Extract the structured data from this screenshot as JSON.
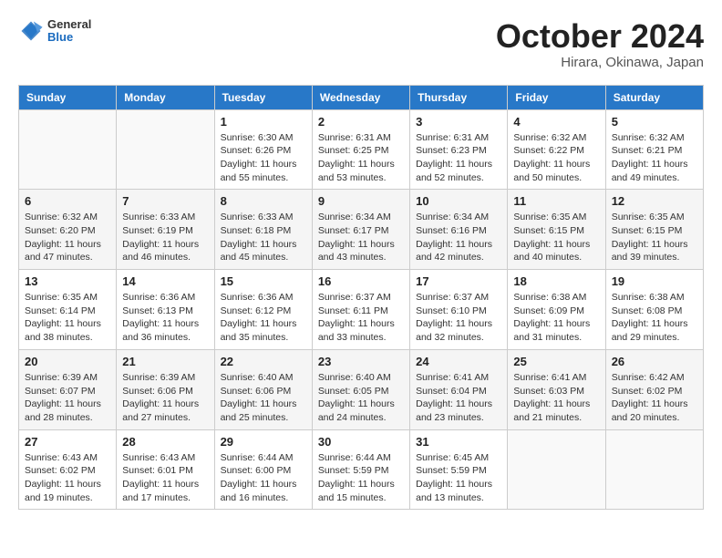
{
  "header": {
    "logo_general": "General",
    "logo_blue": "Blue",
    "month_title": "October 2024",
    "subtitle": "Hirara, Okinawa, Japan"
  },
  "days_of_week": [
    "Sunday",
    "Monday",
    "Tuesday",
    "Wednesday",
    "Thursday",
    "Friday",
    "Saturday"
  ],
  "weeks": [
    [
      {
        "day": "",
        "sunrise": "",
        "sunset": "",
        "daylight": ""
      },
      {
        "day": "",
        "sunrise": "",
        "sunset": "",
        "daylight": ""
      },
      {
        "day": "1",
        "sunrise": "Sunrise: 6:30 AM",
        "sunset": "Sunset: 6:26 PM",
        "daylight": "Daylight: 11 hours and 55 minutes."
      },
      {
        "day": "2",
        "sunrise": "Sunrise: 6:31 AM",
        "sunset": "Sunset: 6:25 PM",
        "daylight": "Daylight: 11 hours and 53 minutes."
      },
      {
        "day": "3",
        "sunrise": "Sunrise: 6:31 AM",
        "sunset": "Sunset: 6:23 PM",
        "daylight": "Daylight: 11 hours and 52 minutes."
      },
      {
        "day": "4",
        "sunrise": "Sunrise: 6:32 AM",
        "sunset": "Sunset: 6:22 PM",
        "daylight": "Daylight: 11 hours and 50 minutes."
      },
      {
        "day": "5",
        "sunrise": "Sunrise: 6:32 AM",
        "sunset": "Sunset: 6:21 PM",
        "daylight": "Daylight: 11 hours and 49 minutes."
      }
    ],
    [
      {
        "day": "6",
        "sunrise": "Sunrise: 6:32 AM",
        "sunset": "Sunset: 6:20 PM",
        "daylight": "Daylight: 11 hours and 47 minutes."
      },
      {
        "day": "7",
        "sunrise": "Sunrise: 6:33 AM",
        "sunset": "Sunset: 6:19 PM",
        "daylight": "Daylight: 11 hours and 46 minutes."
      },
      {
        "day": "8",
        "sunrise": "Sunrise: 6:33 AM",
        "sunset": "Sunset: 6:18 PM",
        "daylight": "Daylight: 11 hours and 45 minutes."
      },
      {
        "day": "9",
        "sunrise": "Sunrise: 6:34 AM",
        "sunset": "Sunset: 6:17 PM",
        "daylight": "Daylight: 11 hours and 43 minutes."
      },
      {
        "day": "10",
        "sunrise": "Sunrise: 6:34 AM",
        "sunset": "Sunset: 6:16 PM",
        "daylight": "Daylight: 11 hours and 42 minutes."
      },
      {
        "day": "11",
        "sunrise": "Sunrise: 6:35 AM",
        "sunset": "Sunset: 6:15 PM",
        "daylight": "Daylight: 11 hours and 40 minutes."
      },
      {
        "day": "12",
        "sunrise": "Sunrise: 6:35 AM",
        "sunset": "Sunset: 6:15 PM",
        "daylight": "Daylight: 11 hours and 39 minutes."
      }
    ],
    [
      {
        "day": "13",
        "sunrise": "Sunrise: 6:35 AM",
        "sunset": "Sunset: 6:14 PM",
        "daylight": "Daylight: 11 hours and 38 minutes."
      },
      {
        "day": "14",
        "sunrise": "Sunrise: 6:36 AM",
        "sunset": "Sunset: 6:13 PM",
        "daylight": "Daylight: 11 hours and 36 minutes."
      },
      {
        "day": "15",
        "sunrise": "Sunrise: 6:36 AM",
        "sunset": "Sunset: 6:12 PM",
        "daylight": "Daylight: 11 hours and 35 minutes."
      },
      {
        "day": "16",
        "sunrise": "Sunrise: 6:37 AM",
        "sunset": "Sunset: 6:11 PM",
        "daylight": "Daylight: 11 hours and 33 minutes."
      },
      {
        "day": "17",
        "sunrise": "Sunrise: 6:37 AM",
        "sunset": "Sunset: 6:10 PM",
        "daylight": "Daylight: 11 hours and 32 minutes."
      },
      {
        "day": "18",
        "sunrise": "Sunrise: 6:38 AM",
        "sunset": "Sunset: 6:09 PM",
        "daylight": "Daylight: 11 hours and 31 minutes."
      },
      {
        "day": "19",
        "sunrise": "Sunrise: 6:38 AM",
        "sunset": "Sunset: 6:08 PM",
        "daylight": "Daylight: 11 hours and 29 minutes."
      }
    ],
    [
      {
        "day": "20",
        "sunrise": "Sunrise: 6:39 AM",
        "sunset": "Sunset: 6:07 PM",
        "daylight": "Daylight: 11 hours and 28 minutes."
      },
      {
        "day": "21",
        "sunrise": "Sunrise: 6:39 AM",
        "sunset": "Sunset: 6:06 PM",
        "daylight": "Daylight: 11 hours and 27 minutes."
      },
      {
        "day": "22",
        "sunrise": "Sunrise: 6:40 AM",
        "sunset": "Sunset: 6:06 PM",
        "daylight": "Daylight: 11 hours and 25 minutes."
      },
      {
        "day": "23",
        "sunrise": "Sunrise: 6:40 AM",
        "sunset": "Sunset: 6:05 PM",
        "daylight": "Daylight: 11 hours and 24 minutes."
      },
      {
        "day": "24",
        "sunrise": "Sunrise: 6:41 AM",
        "sunset": "Sunset: 6:04 PM",
        "daylight": "Daylight: 11 hours and 23 minutes."
      },
      {
        "day": "25",
        "sunrise": "Sunrise: 6:41 AM",
        "sunset": "Sunset: 6:03 PM",
        "daylight": "Daylight: 11 hours and 21 minutes."
      },
      {
        "day": "26",
        "sunrise": "Sunrise: 6:42 AM",
        "sunset": "Sunset: 6:02 PM",
        "daylight": "Daylight: 11 hours and 20 minutes."
      }
    ],
    [
      {
        "day": "27",
        "sunrise": "Sunrise: 6:43 AM",
        "sunset": "Sunset: 6:02 PM",
        "daylight": "Daylight: 11 hours and 19 minutes."
      },
      {
        "day": "28",
        "sunrise": "Sunrise: 6:43 AM",
        "sunset": "Sunset: 6:01 PM",
        "daylight": "Daylight: 11 hours and 17 minutes."
      },
      {
        "day": "29",
        "sunrise": "Sunrise: 6:44 AM",
        "sunset": "Sunset: 6:00 PM",
        "daylight": "Daylight: 11 hours and 16 minutes."
      },
      {
        "day": "30",
        "sunrise": "Sunrise: 6:44 AM",
        "sunset": "Sunset: 5:59 PM",
        "daylight": "Daylight: 11 hours and 15 minutes."
      },
      {
        "day": "31",
        "sunrise": "Sunrise: 6:45 AM",
        "sunset": "Sunset: 5:59 PM",
        "daylight": "Daylight: 11 hours and 13 minutes."
      },
      {
        "day": "",
        "sunrise": "",
        "sunset": "",
        "daylight": ""
      },
      {
        "day": "",
        "sunrise": "",
        "sunset": "",
        "daylight": ""
      }
    ]
  ]
}
